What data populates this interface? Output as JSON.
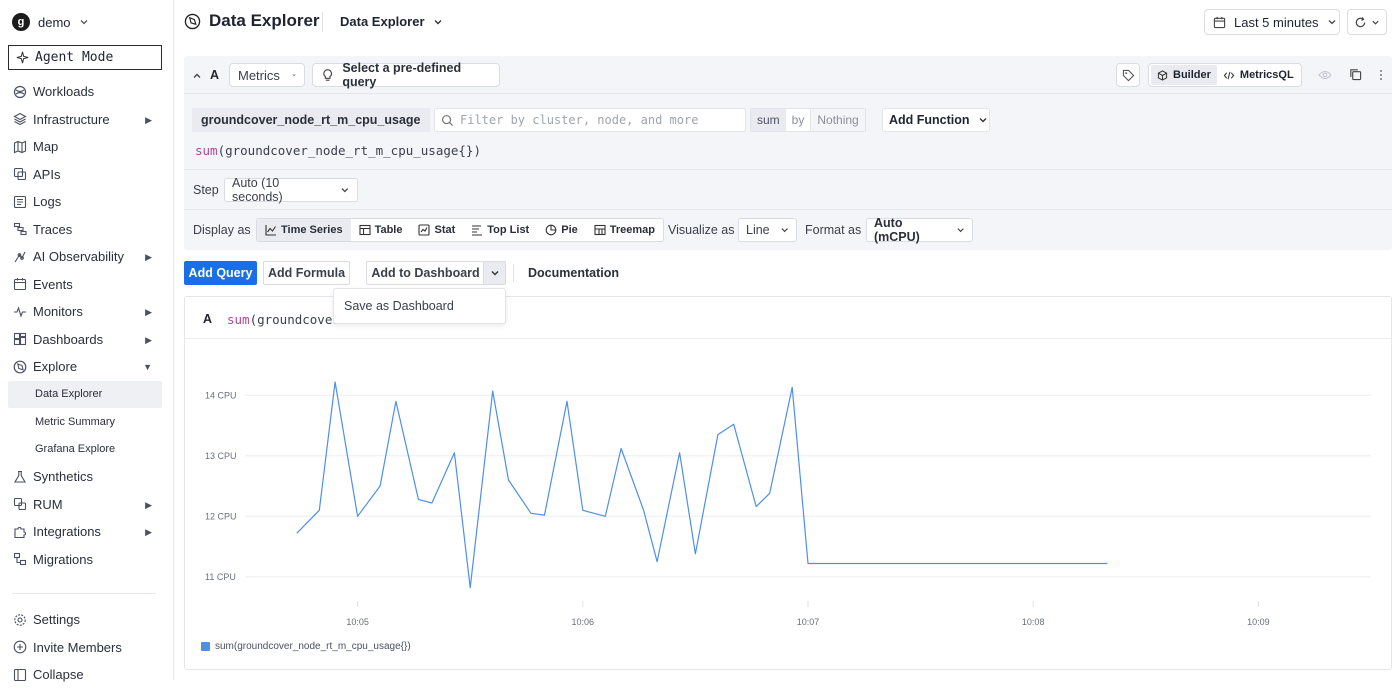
{
  "sidebar": {
    "org": "demo",
    "agent_mode": "Agent Mode",
    "items": [
      {
        "label": "Workloads",
        "icon": "workloads-icon",
        "expandable": false
      },
      {
        "label": "Infrastructure",
        "icon": "layers-icon",
        "expandable": true
      },
      {
        "label": "Map",
        "icon": "map-icon",
        "expandable": false
      },
      {
        "label": "APIs",
        "icon": "api-icon",
        "expandable": false
      },
      {
        "label": "Logs",
        "icon": "logs-icon",
        "expandable": false
      },
      {
        "label": "Traces",
        "icon": "traces-icon",
        "expandable": false
      },
      {
        "label": "AI Observability",
        "icon": "ai-icon",
        "expandable": true
      },
      {
        "label": "Events",
        "icon": "calendar-icon",
        "expandable": false
      },
      {
        "label": "Monitors",
        "icon": "pulse-icon",
        "expandable": true
      },
      {
        "label": "Dashboards",
        "icon": "dashboard-icon",
        "expandable": true
      },
      {
        "label": "Explore",
        "icon": "explore-icon",
        "expandable": true,
        "expanded": true
      }
    ],
    "explore_sub": [
      "Data Explorer",
      "Metric Summary",
      "Grafana Explore"
    ],
    "items_after": [
      {
        "label": "Synthetics",
        "icon": "flask-icon",
        "expandable": false
      },
      {
        "label": "RUM",
        "icon": "rum-icon",
        "expandable": true
      },
      {
        "label": "Integrations",
        "icon": "puzzle-icon",
        "expandable": true
      },
      {
        "label": "Migrations",
        "icon": "migrate-icon",
        "expandable": false
      }
    ],
    "bottom": [
      {
        "label": "Settings",
        "icon": "gear-icon"
      },
      {
        "label": "Invite Members",
        "icon": "plus-circle-icon"
      },
      {
        "label": "Collapse",
        "icon": "collapse-icon"
      }
    ]
  },
  "header": {
    "title": "Data Explorer",
    "dropdown": "Data Explorer",
    "time_range": "Last 5 minutes"
  },
  "query": {
    "letter": "A",
    "source": "Metrics",
    "predefined": "Select a pre-defined query",
    "builder": "Builder",
    "metricsql": "MetricsQL",
    "metric": "groundcover_node_rt_m_cpu_usage",
    "filter_placeholder": "Filter by cluster, node, and more",
    "agg": "sum",
    "by": "by",
    "group": "Nothing",
    "add_function": "Add Function",
    "expr_fn": "sum",
    "expr_rest": "(groundcover_node_rt_m_cpu_usage{})",
    "step_label": "Step",
    "step_value": "Auto (10 seconds)",
    "display_label": "Display as",
    "display_options": [
      "Time Series",
      "Table",
      "Stat",
      "Top List",
      "Pie",
      "Treemap"
    ],
    "visualize_label": "Visualize as",
    "visualize_value": "Line",
    "format_label": "Format as",
    "format_value": "Auto (mCPU)"
  },
  "actions": {
    "add_query": "Add Query",
    "add_formula": "Add Formula",
    "add_to_dashboard": "Add to Dashboard",
    "documentation": "Documentation",
    "menu_item": "Save as Dashboard"
  },
  "chart_card": {
    "letter": "A",
    "expr_fn": "sum",
    "expr_rest": "(groundcover"
  },
  "chart_data": {
    "type": "line",
    "x_ticks": [
      "10:05",
      "10:06",
      "10:07",
      "10:08",
      "10:09"
    ],
    "y_ticks": [
      "11 CPU",
      "12 CPU",
      "13 CPU",
      "14 CPU"
    ],
    "ylim": [
      10.6,
      14.6
    ],
    "series": [
      {
        "name": "sum(groundcover_node_rt_m_cpu_usage{})",
        "color": "#4f8fe8",
        "x_minutes": [
          4.73,
          4.83,
          4.9,
          5.0,
          5.1,
          5.17,
          5.27,
          5.33,
          5.43,
          5.5,
          5.6,
          5.67,
          5.77,
          5.83,
          5.93,
          6.0,
          6.1,
          6.17,
          6.27,
          6.33,
          6.43,
          6.5,
          6.6,
          6.67,
          6.77,
          6.83,
          6.93,
          7.0,
          7.1,
          7.17,
          7.27,
          7.33,
          7.43,
          7.5,
          7.6,
          7.67,
          7.77,
          7.83,
          7.93,
          8.0,
          8.1,
          8.17,
          8.27,
          8.33
        ],
        "values": [
          11.72,
          12.1,
          14.22,
          12.0,
          12.5,
          13.9,
          12.28,
          12.22,
          13.05,
          10.82,
          14.07,
          12.6,
          12.05,
          12.02,
          13.9,
          12.1,
          12.0,
          13.12,
          12.1,
          11.25,
          13.05,
          11.38,
          13.35,
          13.52,
          12.16,
          12.38,
          14.13,
          11.22,
          11.22,
          11.22,
          11.22,
          11.22,
          11.22,
          11.22,
          11.22,
          11.22,
          11.22,
          11.22,
          11.22,
          11.22,
          11.22,
          11.22,
          11.22,
          11.22
        ]
      }
    ]
  }
}
